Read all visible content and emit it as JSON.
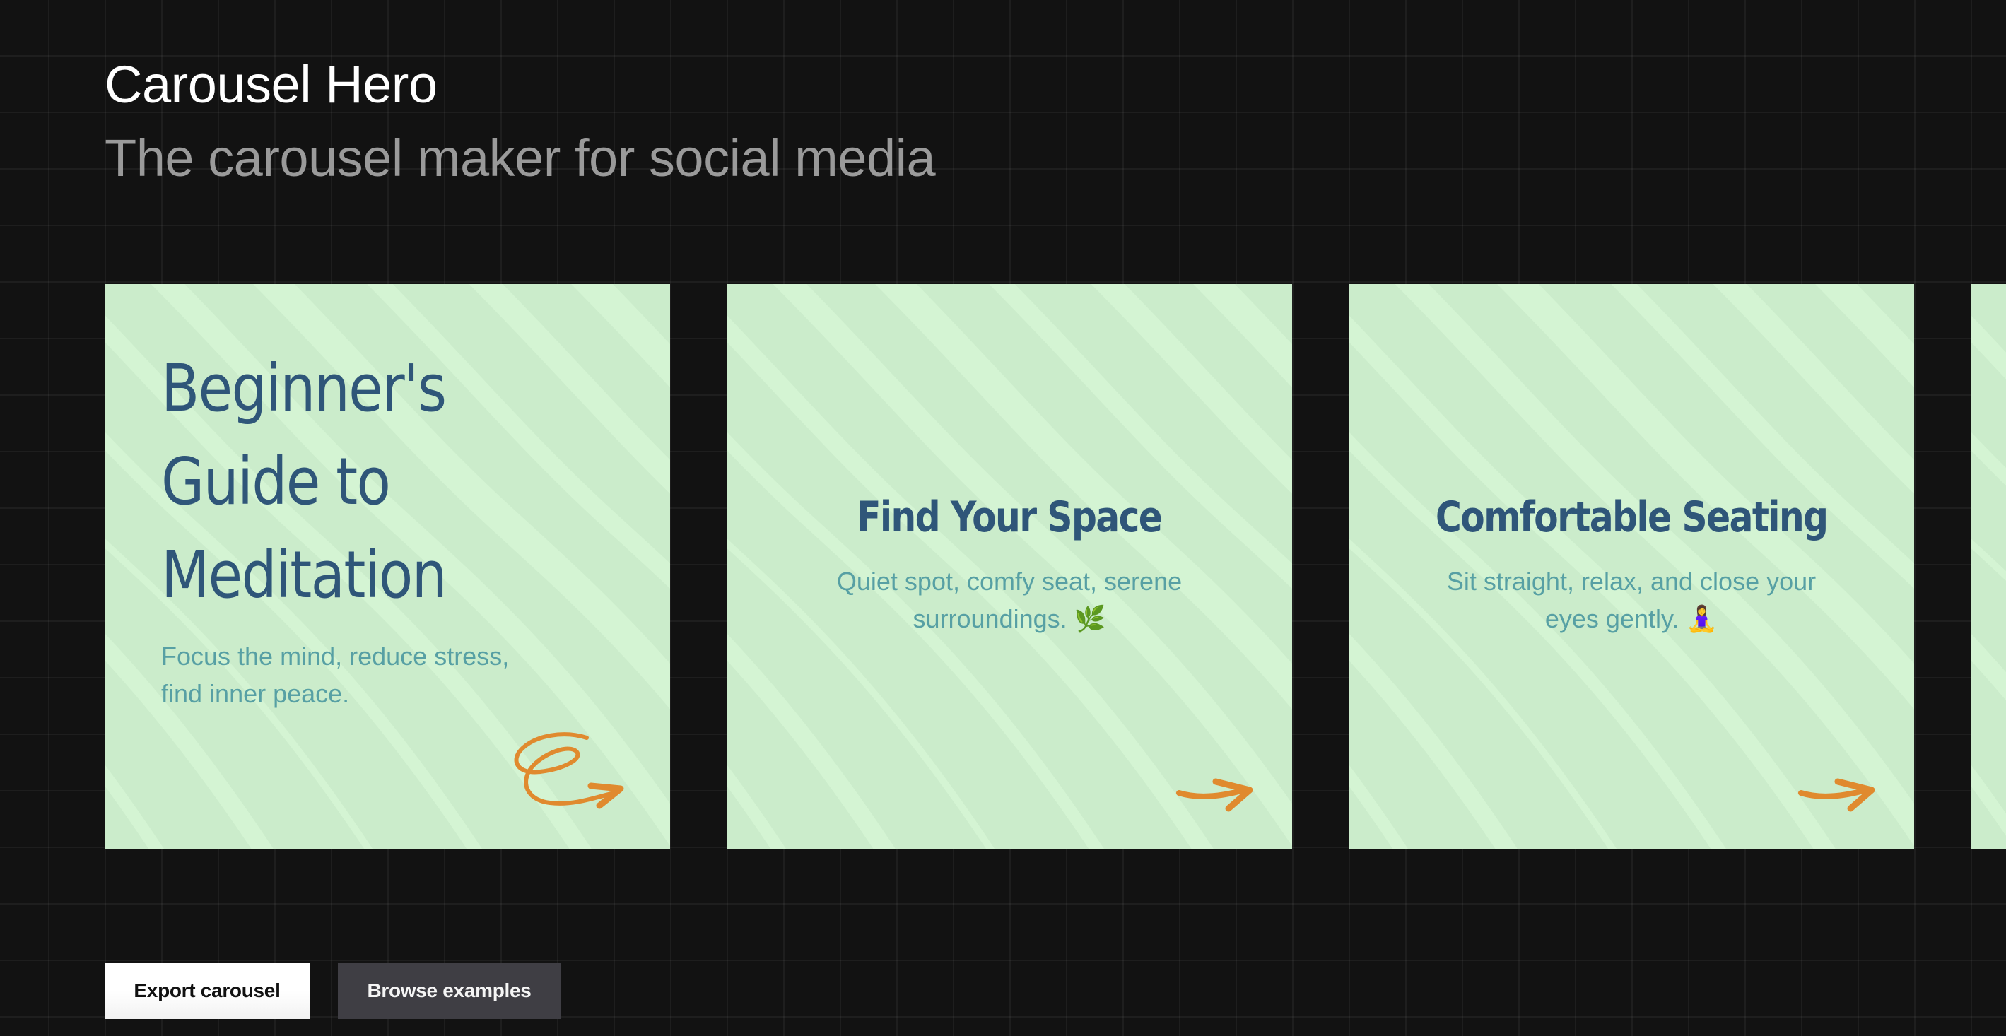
{
  "header": {
    "title": "Carousel Hero",
    "subtitle": "The carousel maker for social media"
  },
  "theme": {
    "page_background": "#121212",
    "slide_background": "#cbeccb",
    "slide_ripple": "#d6f6d5",
    "title_color": "#2f5679",
    "body_color": "#57a0a4",
    "arrow_color": "#e08a2e"
  },
  "carousel": {
    "slides": [
      {
        "type": "cover",
        "title": "Beginner's Guide to Meditation",
        "body": "Focus the mind, reduce stress, find inner peace.",
        "arrow_icon": "curly-arrow-right-icon"
      },
      {
        "type": "inner",
        "title": "Find Your Space",
        "body": "Quiet spot, comfy seat, serene surroundings. 🌿",
        "arrow_icon": "arrow-right-icon"
      },
      {
        "type": "inner",
        "title": "Comfortable Seating",
        "body": "Sit straight, relax, and close your eyes gently. 🧘‍♀️",
        "arrow_icon": "arrow-right-icon"
      },
      {
        "type": "inner",
        "title": "",
        "body": "",
        "arrow_icon": ""
      }
    ]
  },
  "actions": {
    "export_label": "Export carousel",
    "browse_label": "Browse examples"
  }
}
